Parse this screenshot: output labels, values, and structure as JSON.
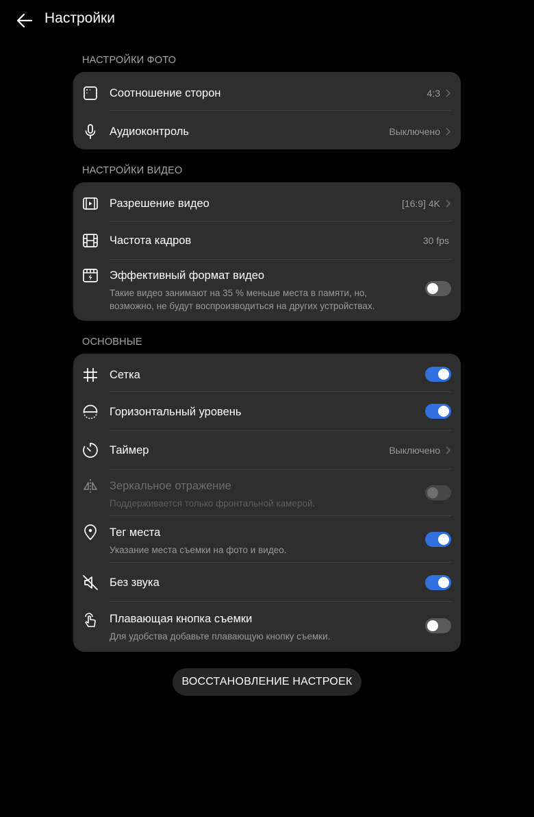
{
  "header": {
    "title": "Настройки"
  },
  "photo": {
    "section_label": "НАСТРОЙКИ ФОТО",
    "aspect": {
      "title": "Соотношение сторон",
      "value": "4:3"
    },
    "audio": {
      "title": "Аудиоконтроль",
      "value": "Выключено"
    }
  },
  "video": {
    "section_label": "НАСТРОЙКИ ВИДЕО",
    "resolution": {
      "title": "Разрешение видео",
      "value": "[16:9] 4K"
    },
    "framerate": {
      "title": "Частота кадров",
      "value": "30 fps"
    },
    "efficient": {
      "title": "Эффективный формат видео",
      "subtitle": "Такие видео занимают на 35 % меньше места в памяти, но, возможно, не будут воспроизводиться на других устройствах.",
      "enabled": false
    }
  },
  "general": {
    "section_label": "ОСНОВНЫЕ",
    "grid": {
      "title": "Сетка",
      "enabled": true
    },
    "level": {
      "title": "Горизонтальный уровень",
      "enabled": true
    },
    "timer": {
      "title": "Таймер",
      "value": "Выключено"
    },
    "mirror": {
      "title": "Зеркальное отражение",
      "subtitle": "Поддерживается только фронтальной камерой.",
      "enabled": false,
      "disabled": true
    },
    "location": {
      "title": "Тег места",
      "subtitle": "Указание места съемки на фото и видео.",
      "enabled": true
    },
    "mute": {
      "title": "Без звука",
      "enabled": true
    },
    "floating": {
      "title": "Плавающая кнопка съемки",
      "subtitle": "Для удобства добавьте плавающую кнопку съемки.",
      "enabled": false
    }
  },
  "reset_button": "ВОССТАНОВЛЕНИЕ НАСТРОЕК",
  "colors": {
    "accent": "#2f6fde",
    "card": "#2e2e2e",
    "background": "#000000"
  }
}
